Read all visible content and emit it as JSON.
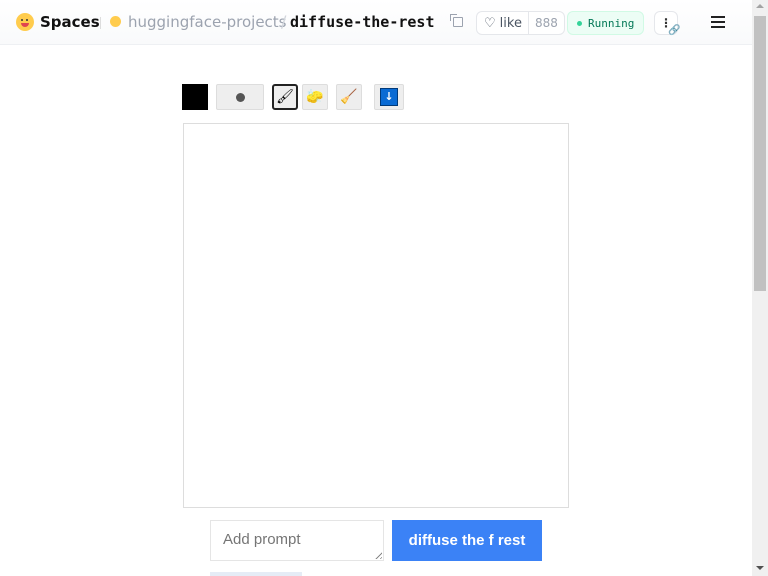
{
  "header": {
    "brand": "Spaces",
    "org": "huggingface-projects",
    "separator": "/",
    "repo": "diffuse-the-rest",
    "like_label": "like",
    "like_count": "888",
    "status": "Running",
    "more_label": "⋮",
    "link_glyph": "🔗"
  },
  "toolbar": {
    "color": "#000000",
    "brush_glyph": "🖌",
    "eraser_glyph": "🧽",
    "fill_glyph": "🧹",
    "download_glyph": "↓"
  },
  "prompt": {
    "placeholder": "Add prompt",
    "value": ""
  },
  "actions": {
    "diffuse_label": "diffuse the f rest"
  },
  "colors": {
    "accent": "#3b82f6",
    "status_green": "#047857"
  }
}
